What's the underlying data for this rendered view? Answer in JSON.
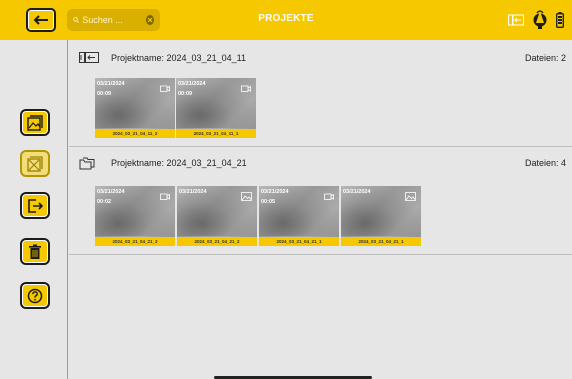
{
  "header": {
    "title": "PROJEKTE",
    "search_placeholder": "Suchen ..."
  },
  "colors": {
    "accent": "#f5c800",
    "background": "#e6e6e6",
    "dark": "#1c1c1c"
  },
  "sidebar": {
    "items": [
      {
        "icon": "image-folder-icon",
        "state": "enabled"
      },
      {
        "icon": "image-crossed-icon",
        "state": "disabled"
      },
      {
        "icon": "export-icon",
        "state": "enabled"
      },
      {
        "icon": "trash-icon",
        "state": "enabled"
      },
      {
        "icon": "help-icon",
        "state": "enabled"
      }
    ]
  },
  "projects": [
    {
      "name": "Projektname: 2024_03_21_04_11",
      "count": "Dateien: 2",
      "icon": "camera-import-icon",
      "files": [
        {
          "date": "03/21/2024",
          "duration": "00:09",
          "caption": "2024_03_21_04_11_2",
          "type": "video-icon"
        },
        {
          "date": "03/21/2024",
          "duration": "00:09",
          "caption": "2024_03_21_04_11_1",
          "type": "video-icon"
        }
      ]
    },
    {
      "name": "Projektname: 2024_03_21_04_21",
      "count": "Dateien: 4",
      "icon": "folder-icon",
      "files": [
        {
          "date": "03/21/2024",
          "duration": "00:02",
          "caption": "2024_03_21_04_21_2",
          "type": "video-icon"
        },
        {
          "date": "03/21/2024",
          "duration": "",
          "caption": "2024_03_21_04_21_2",
          "type": "photo-icon"
        },
        {
          "date": "03/21/2024",
          "duration": "00:05",
          "caption": "2024_03_21_04_21_1",
          "type": "video-icon"
        },
        {
          "date": "03/21/2024",
          "duration": "",
          "caption": "2024_03_21_04_21_1",
          "type": "photo-icon"
        }
      ]
    }
  ]
}
